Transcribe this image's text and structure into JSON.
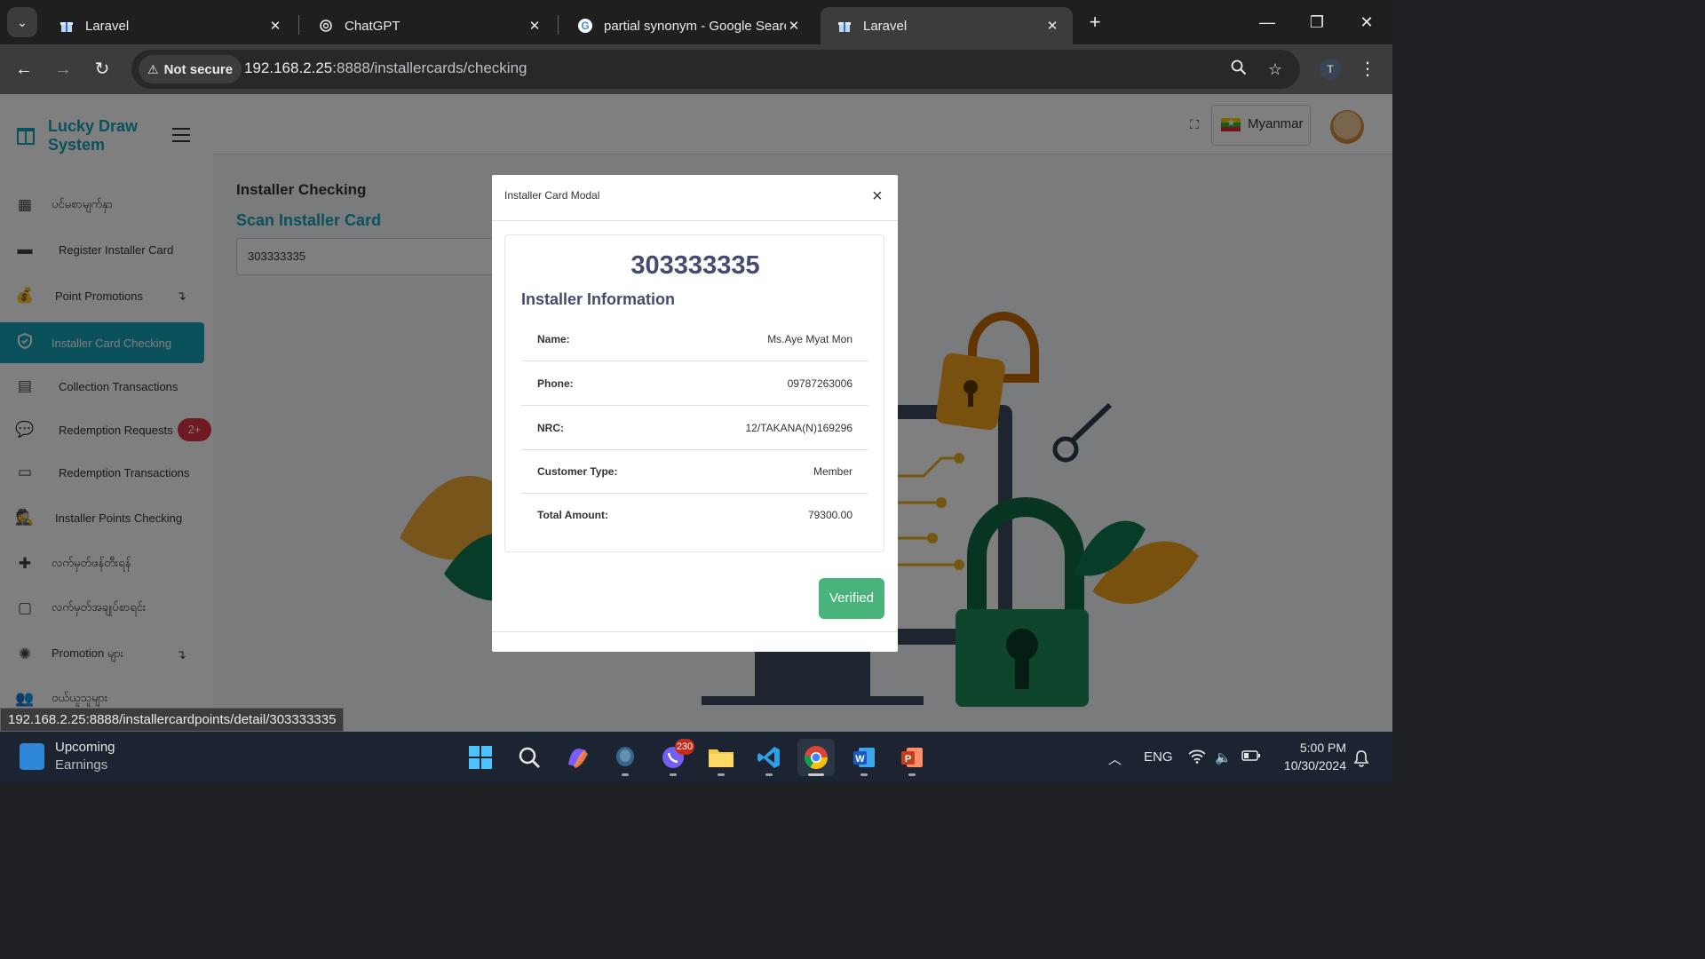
{
  "browser": {
    "tabs": [
      {
        "title": "Laravel",
        "icon": "gift-icon"
      },
      {
        "title": "ChatGPT",
        "icon": "openai-icon"
      },
      {
        "title": "partial synonym - Google Search",
        "icon": "google-icon"
      },
      {
        "title": "Laravel",
        "icon": "gift-icon",
        "active": true
      }
    ],
    "security_label": "Not secure",
    "url_host": "192.168.2.25",
    "url_rest": ":8888/installercards/checking",
    "profile_initial": "T",
    "status_link": "192.168.2.25:8888/installercardpoints/detail/303333335"
  },
  "app": {
    "brand": "Lucky Draw System",
    "language": "Myanmar",
    "sidebar": [
      {
        "label": "ပင်မစာမျက်နှာ",
        "icon": "dashboard-icon"
      },
      {
        "label": "Register Installer Card",
        "icon": "id-card-icon"
      },
      {
        "label": "Point Promotions",
        "icon": "money-bag-icon",
        "arrow": "↴"
      },
      {
        "label": "Installer Card Checking",
        "icon": "shield-icon",
        "active": true
      },
      {
        "label": "Collection Transactions",
        "icon": "receipt-icon"
      },
      {
        "label": "Redemption Requests",
        "icon": "chat-icon",
        "badge": "2+"
      },
      {
        "label": "Redemption Transactions",
        "icon": "money-check-icon"
      },
      {
        "label": "Installer Points Checking",
        "icon": "spy-icon"
      },
      {
        "label": "လက်မှတ်ဖန်တီးရန်",
        "icon": "ticket-add-icon"
      },
      {
        "label": "လက်မှတ်အချုပ်စာရင်း",
        "icon": "ticket-list-icon"
      },
      {
        "label": "Promotion များ",
        "icon": "promotion-icon",
        "arrow": "↴"
      },
      {
        "label": "ဝယ်ယူသူများ",
        "icon": "users-icon"
      }
    ],
    "content": {
      "title": "Installer Checking",
      "subtitle": "Scan Installer Card",
      "scan_value": "303333335"
    }
  },
  "modal": {
    "title": "Installer Card Modal",
    "card_number": "303333335",
    "heading": "Installer Information",
    "rows": [
      {
        "label": "Name:",
        "value": "Ms.Aye Myat Mon"
      },
      {
        "label": "Phone:",
        "value": "09787263006"
      },
      {
        "label": "NRC:",
        "value": "12/TAKANA(N)169296"
      },
      {
        "label": "Customer Type:",
        "value": "Member"
      },
      {
        "label": "Total Amount:",
        "value": "79300.00"
      }
    ],
    "button": "Verified"
  },
  "taskbar": {
    "widget_line1": "Upcoming",
    "widget_line2": "Earnings",
    "language": "ENG",
    "time": "5:00 PM",
    "date": "10/30/2024",
    "viber_badge": "230"
  },
  "colors": {
    "accent": "#17a2b8",
    "verified": "#48b37a",
    "badge": "#dc3545"
  }
}
